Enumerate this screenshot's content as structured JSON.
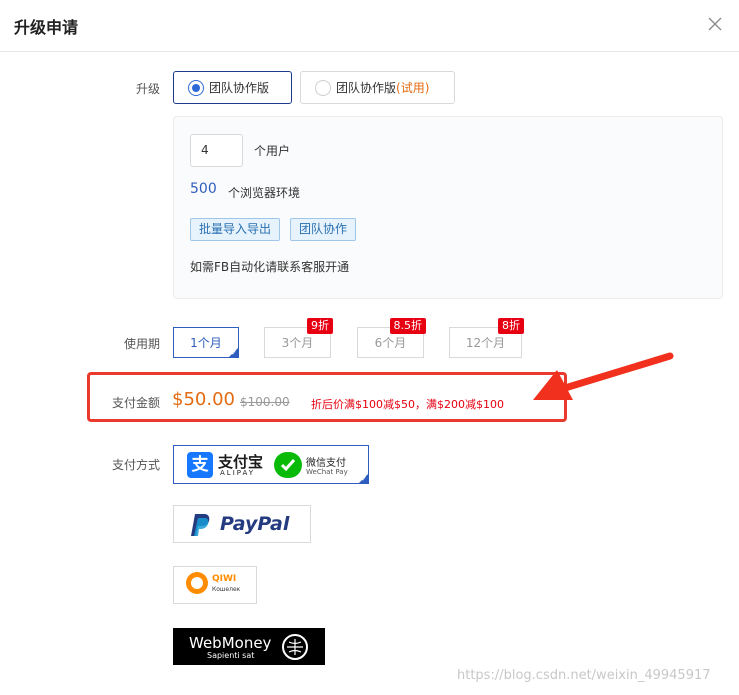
{
  "dialog": {
    "title": "升级申请"
  },
  "upgrade": {
    "label": "升级",
    "options": [
      {
        "label": "团队协作版",
        "suffix": ""
      },
      {
        "label": "团队协作版",
        "suffix": "(试用)"
      }
    ]
  },
  "plan": {
    "user_count": "4",
    "user_unit": "个用户",
    "browser_count": "500",
    "browser_unit": "个浏览器环境",
    "tags": [
      "批量导入导出",
      "团队协作"
    ],
    "note": "如需FB自动化请联系客服开通"
  },
  "period": {
    "label": "使用期",
    "options": [
      {
        "label": "1个月",
        "discount": ""
      },
      {
        "label": "3个月",
        "discount": "9折"
      },
      {
        "label": "6个月",
        "discount": "8.5折"
      },
      {
        "label": "12个月",
        "discount": "8折"
      }
    ]
  },
  "payment_amount": {
    "label": "支付金额",
    "price": "$50.00",
    "original": "$100.00",
    "promo": "折后价满$100减$50，满$200减$100"
  },
  "payment_method": {
    "label": "支付方式",
    "alipay": {
      "cn": "支付宝",
      "en": "ALIPAY"
    },
    "wechat": {
      "cn": "微信支付",
      "en": "WeChat Pay"
    },
    "paypal": "PayPal",
    "qiwi": {
      "name": "QIWI",
      "sub": "Кошелек"
    },
    "webmoney": {
      "name": "WebMoney",
      "sub": "Sapienti sat"
    }
  },
  "watermark": "https://blog.csdn.net/weixin_49945917",
  "colors": {
    "accent_blue": "#2f5dbd",
    "price_orange": "#e36b14",
    "alert_red": "#e60012",
    "alipay_blue": "#1677ff",
    "wechat_green": "#09bb07",
    "paypal_dark": "#253b80",
    "paypal_light": "#179bd7",
    "qiwi_orange": "#ff8c00"
  }
}
